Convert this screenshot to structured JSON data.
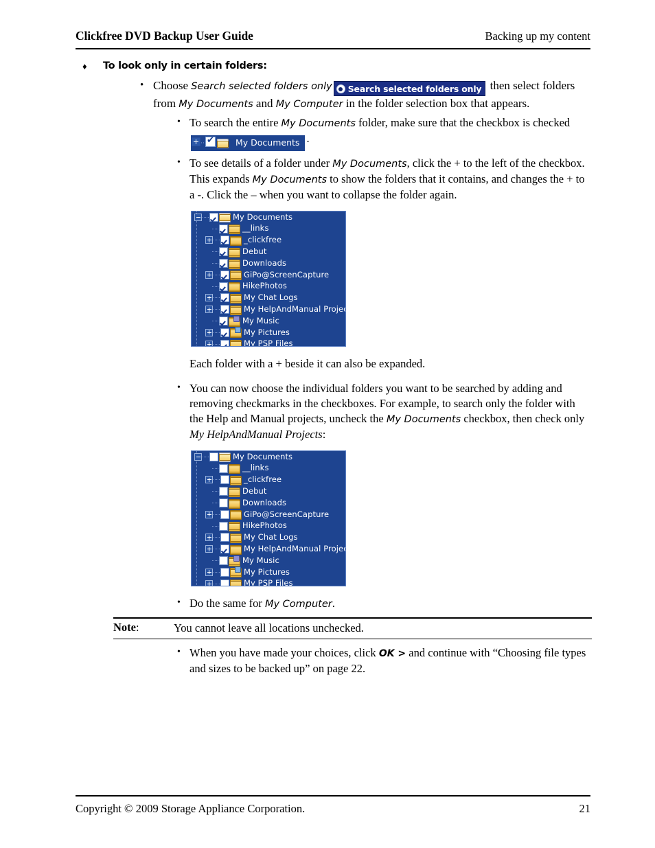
{
  "header": {
    "left_title": "Clickfree DVD Backup User Guide",
    "right_title": "Backing up my content"
  },
  "footer": {
    "copyright": "Copyright © 2009  Storage Appliance Corporation.",
    "page_number": "21"
  },
  "section": {
    "heading": "To look only in certain folders:",
    "diamond_marker": "♦"
  },
  "bullets": {
    "choose_pre": "Choose ",
    "choose_italic": "Search selected folders only",
    "choose_post": " then select folders from ",
    "choose_mydocs": "My Documents",
    "choose_and": " and ",
    "choose_mycomp": "My Computer",
    "choose_tail": " in the folder selection box that appears.",
    "entire_pre": "To search the entire ",
    "entire_italic": "My Documents",
    "entire_mid": " folder, make sure that the checkbox is checked ",
    "entire_tail": ".",
    "details_a": "To see details of a folder under ",
    "details_italic1": "My Documents",
    "details_b": ", click the + to the left of the checkbox. This expands ",
    "details_italic2": "My Documents",
    "details_c": " to show the folders that it contains, and changes the + to a -. Click the – when you want to collapse the folder again.",
    "expand_note": "Each folder with a + beside it can also be expanded.",
    "choose_individual_a": "You can now choose the individual folders you want to be searched by adding and removing checkmarks in the checkboxes. For example, to search only the folder with the Help and Manual projects, uncheck the ",
    "choose_individual_italic1": "My Documents",
    "choose_individual_b": " checkbox, then check only ",
    "choose_individual_italic2": "My HelpAndManual Projects",
    "choose_individual_c": ":",
    "do_same_pre": "Do the same for ",
    "do_same_italic": "My Computer",
    "do_same_post": ".",
    "final_a": "When you have made your choices, click ",
    "final_ok": "OK >",
    "final_b": " and continue with “Choosing file types and sizes to be backed up” on page 22."
  },
  "note": {
    "label": "Note",
    "colon": ":",
    "text": "You cannot leave all locations unchecked."
  },
  "inline_graphics": {
    "search_button": {
      "label": "Search selected folders only",
      "radio_selected": true,
      "bg_color": "#1c2f86",
      "text_color": "#ffffff"
    },
    "mydocs_chip": {
      "label": "My Documents",
      "checked": true,
      "expander": "plus",
      "bg_color": "#1e4490"
    }
  },
  "tree_screenshot_1": {
    "bg_color": "#1e4490",
    "border_color": "#5b7ec2",
    "rows": [
      {
        "label": "My Documents",
        "level": 0,
        "expander": "minus",
        "checked": true,
        "icon": "documents-folder-icon"
      },
      {
        "label": "__links",
        "level": 1,
        "expander": "none",
        "checked": true,
        "icon": "folder-icon"
      },
      {
        "label": "_clickfree",
        "level": 1,
        "expander": "plus",
        "checked": true,
        "icon": "folder-icon"
      },
      {
        "label": "Debut",
        "level": 1,
        "expander": "none",
        "checked": true,
        "icon": "folder-icon"
      },
      {
        "label": "Downloads",
        "level": 1,
        "expander": "none",
        "checked": true,
        "icon": "folder-icon"
      },
      {
        "label": "GiPo@ScreenCapture",
        "level": 1,
        "expander": "plus",
        "checked": true,
        "icon": "folder-icon"
      },
      {
        "label": "HikePhotos",
        "level": 1,
        "expander": "none",
        "checked": true,
        "icon": "folder-icon"
      },
      {
        "label": "My Chat Logs",
        "level": 1,
        "expander": "plus",
        "checked": true,
        "icon": "folder-icon"
      },
      {
        "label": "My HelpAndManual Projects",
        "level": 1,
        "expander": "plus",
        "checked": true,
        "icon": "folder-icon"
      },
      {
        "label": "My Music",
        "level": 1,
        "expander": "none",
        "checked": true,
        "icon": "music-folder-icon"
      },
      {
        "label": "My Pictures",
        "level": 1,
        "expander": "plus",
        "checked": true,
        "icon": "pictures-folder-icon"
      },
      {
        "label": "My PSP Files",
        "level": 1,
        "expander": "plus",
        "checked": true,
        "icon": "folder-icon"
      }
    ]
  },
  "tree_screenshot_2": {
    "bg_color": "#1e4490",
    "border_color": "#5b7ec2",
    "rows": [
      {
        "label": "My Documents",
        "level": 0,
        "expander": "minus",
        "checked": false,
        "icon": "documents-folder-icon"
      },
      {
        "label": "__links",
        "level": 1,
        "expander": "none",
        "checked": false,
        "icon": "folder-icon"
      },
      {
        "label": "_clickfree",
        "level": 1,
        "expander": "plus",
        "checked": false,
        "icon": "folder-icon"
      },
      {
        "label": "Debut",
        "level": 1,
        "expander": "none",
        "checked": false,
        "icon": "folder-icon"
      },
      {
        "label": "Downloads",
        "level": 1,
        "expander": "none",
        "checked": false,
        "icon": "folder-icon"
      },
      {
        "label": "GiPo@ScreenCapture",
        "level": 1,
        "expander": "plus",
        "checked": false,
        "icon": "folder-icon"
      },
      {
        "label": "HikePhotos",
        "level": 1,
        "expander": "none",
        "checked": false,
        "icon": "folder-icon"
      },
      {
        "label": "My Chat Logs",
        "level": 1,
        "expander": "plus",
        "checked": false,
        "icon": "folder-icon"
      },
      {
        "label": "My HelpAndManual Projects",
        "level": 1,
        "expander": "plus",
        "checked": true,
        "icon": "folder-icon"
      },
      {
        "label": "My Music",
        "level": 1,
        "expander": "none",
        "checked": false,
        "icon": "music-folder-icon"
      },
      {
        "label": "My Pictures",
        "level": 1,
        "expander": "plus",
        "checked": false,
        "icon": "pictures-folder-icon"
      },
      {
        "label": "My PSP Files",
        "level": 1,
        "expander": "plus",
        "checked": false,
        "icon": "folder-icon"
      }
    ]
  }
}
